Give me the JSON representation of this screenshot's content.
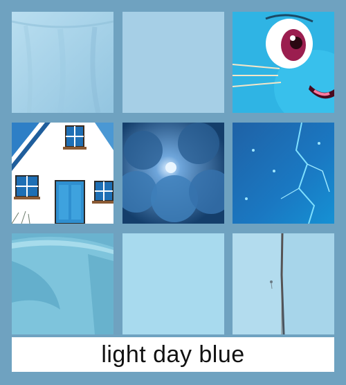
{
  "caption": "light day blue",
  "colors": {
    "background": "#6fa2c0",
    "tiles": [
      "#a9d3ea",
      "#a5cfe6",
      "#2fb8e6",
      "#ffffff",
      "#1e5a8d",
      "#1b6fb3",
      "#7cc3da",
      "#a8daed",
      "#a7d4ea"
    ]
  },
  "tiles": [
    {
      "name": "fabric",
      "icon": "fabric-icon"
    },
    {
      "name": "plain-swatch",
      "icon": "swatch-icon"
    },
    {
      "name": "cartoon-cat",
      "icon": "cat-face-icon"
    },
    {
      "name": "house",
      "icon": "house-icon"
    },
    {
      "name": "night-clouds",
      "icon": "cloud-icon"
    },
    {
      "name": "lightning",
      "icon": "lightning-icon"
    },
    {
      "name": "cup",
      "icon": "cup-icon"
    },
    {
      "name": "plain-swatch-2",
      "icon": "swatch-icon"
    },
    {
      "name": "painted-wall",
      "icon": "wall-icon"
    }
  ]
}
